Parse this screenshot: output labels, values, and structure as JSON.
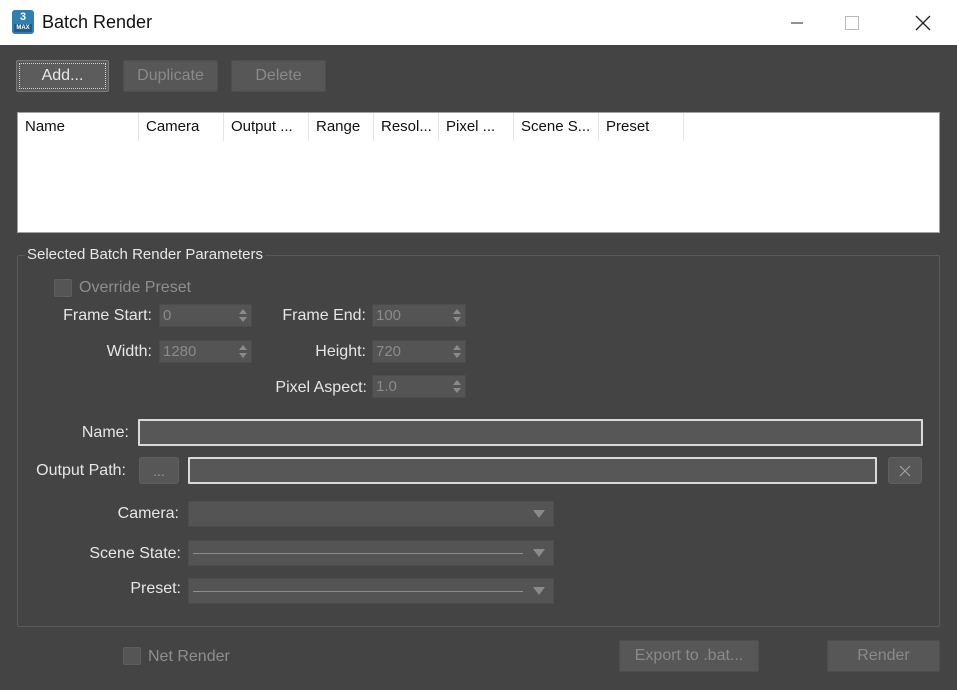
{
  "window": {
    "title": "Batch Render",
    "icon": {
      "top": "3",
      "bottom": "MAX"
    }
  },
  "toolbar": {
    "add_label": "Add...",
    "duplicate_label": "Duplicate",
    "delete_label": "Delete"
  },
  "list": {
    "columns": [
      "Name",
      "Camera",
      "Output ...",
      "Range",
      "Resol...",
      "Pixel ...",
      "Scene S...",
      "Preset"
    ]
  },
  "params": {
    "group_title": "Selected Batch Render Parameters",
    "override_preset": "Override Preset",
    "frame_start_label": "Frame Start:",
    "frame_start_value": "0",
    "frame_end_label": "Frame End:",
    "frame_end_value": "100",
    "width_label": "Width:",
    "width_value": "1280",
    "height_label": "Height:",
    "height_value": "720",
    "pixel_aspect_label": "Pixel Aspect:",
    "pixel_aspect_value": "1.0",
    "name_label": "Name:",
    "name_value": "",
    "output_path_label": "Output Path:",
    "output_browse_label": "...",
    "output_path_value": "",
    "camera_label": "Camera:",
    "scene_state_label": "Scene State:",
    "preset_label": "Preset:"
  },
  "footer": {
    "net_render_label": "Net Render",
    "export_label": "Export to .bat...",
    "render_label": "Render"
  },
  "colors": {
    "background": "#444444",
    "titlebar": "#ffffff",
    "text": "#e6e6e6",
    "disabled_text": "#8e8e8e"
  }
}
